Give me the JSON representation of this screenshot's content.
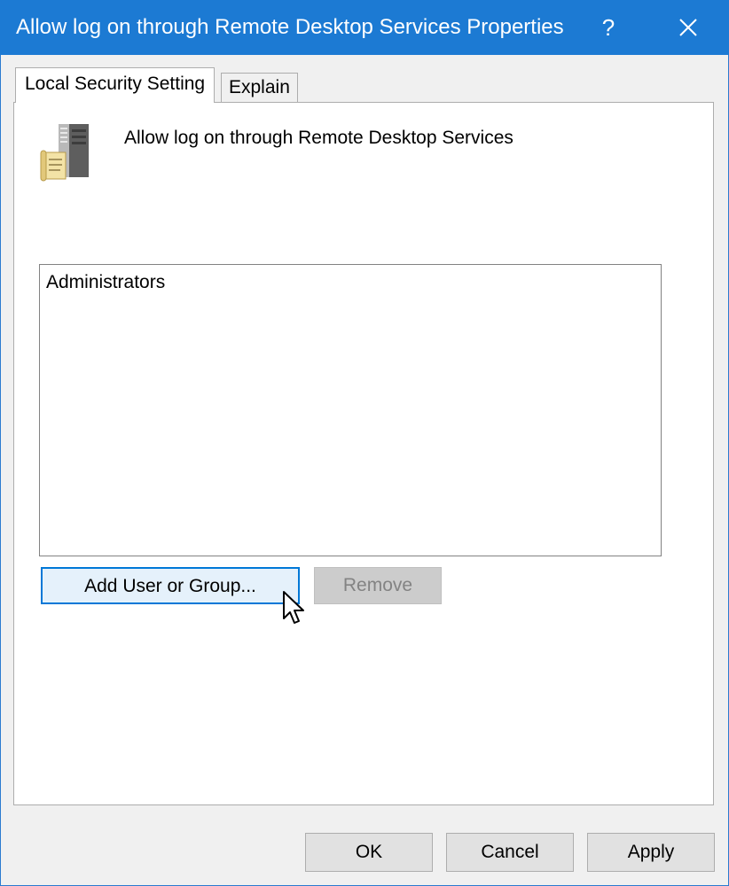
{
  "window": {
    "title": "Allow log on through Remote Desktop Services Properties",
    "help_label": "?",
    "accent_color": "#1c7ad3"
  },
  "tabs": [
    {
      "label": "Local Security Setting",
      "selected": true
    },
    {
      "label": "Explain",
      "selected": false
    }
  ],
  "policy": {
    "icon": "server-policy-icon",
    "name": "Allow log on through Remote Desktop Services"
  },
  "members": {
    "items": [
      "Administrators"
    ]
  },
  "actions": {
    "add_label": "Add User or Group...",
    "remove_label": "Remove",
    "remove_enabled": false
  },
  "footer": {
    "ok_label": "OK",
    "cancel_label": "Cancel",
    "apply_label": "Apply"
  }
}
